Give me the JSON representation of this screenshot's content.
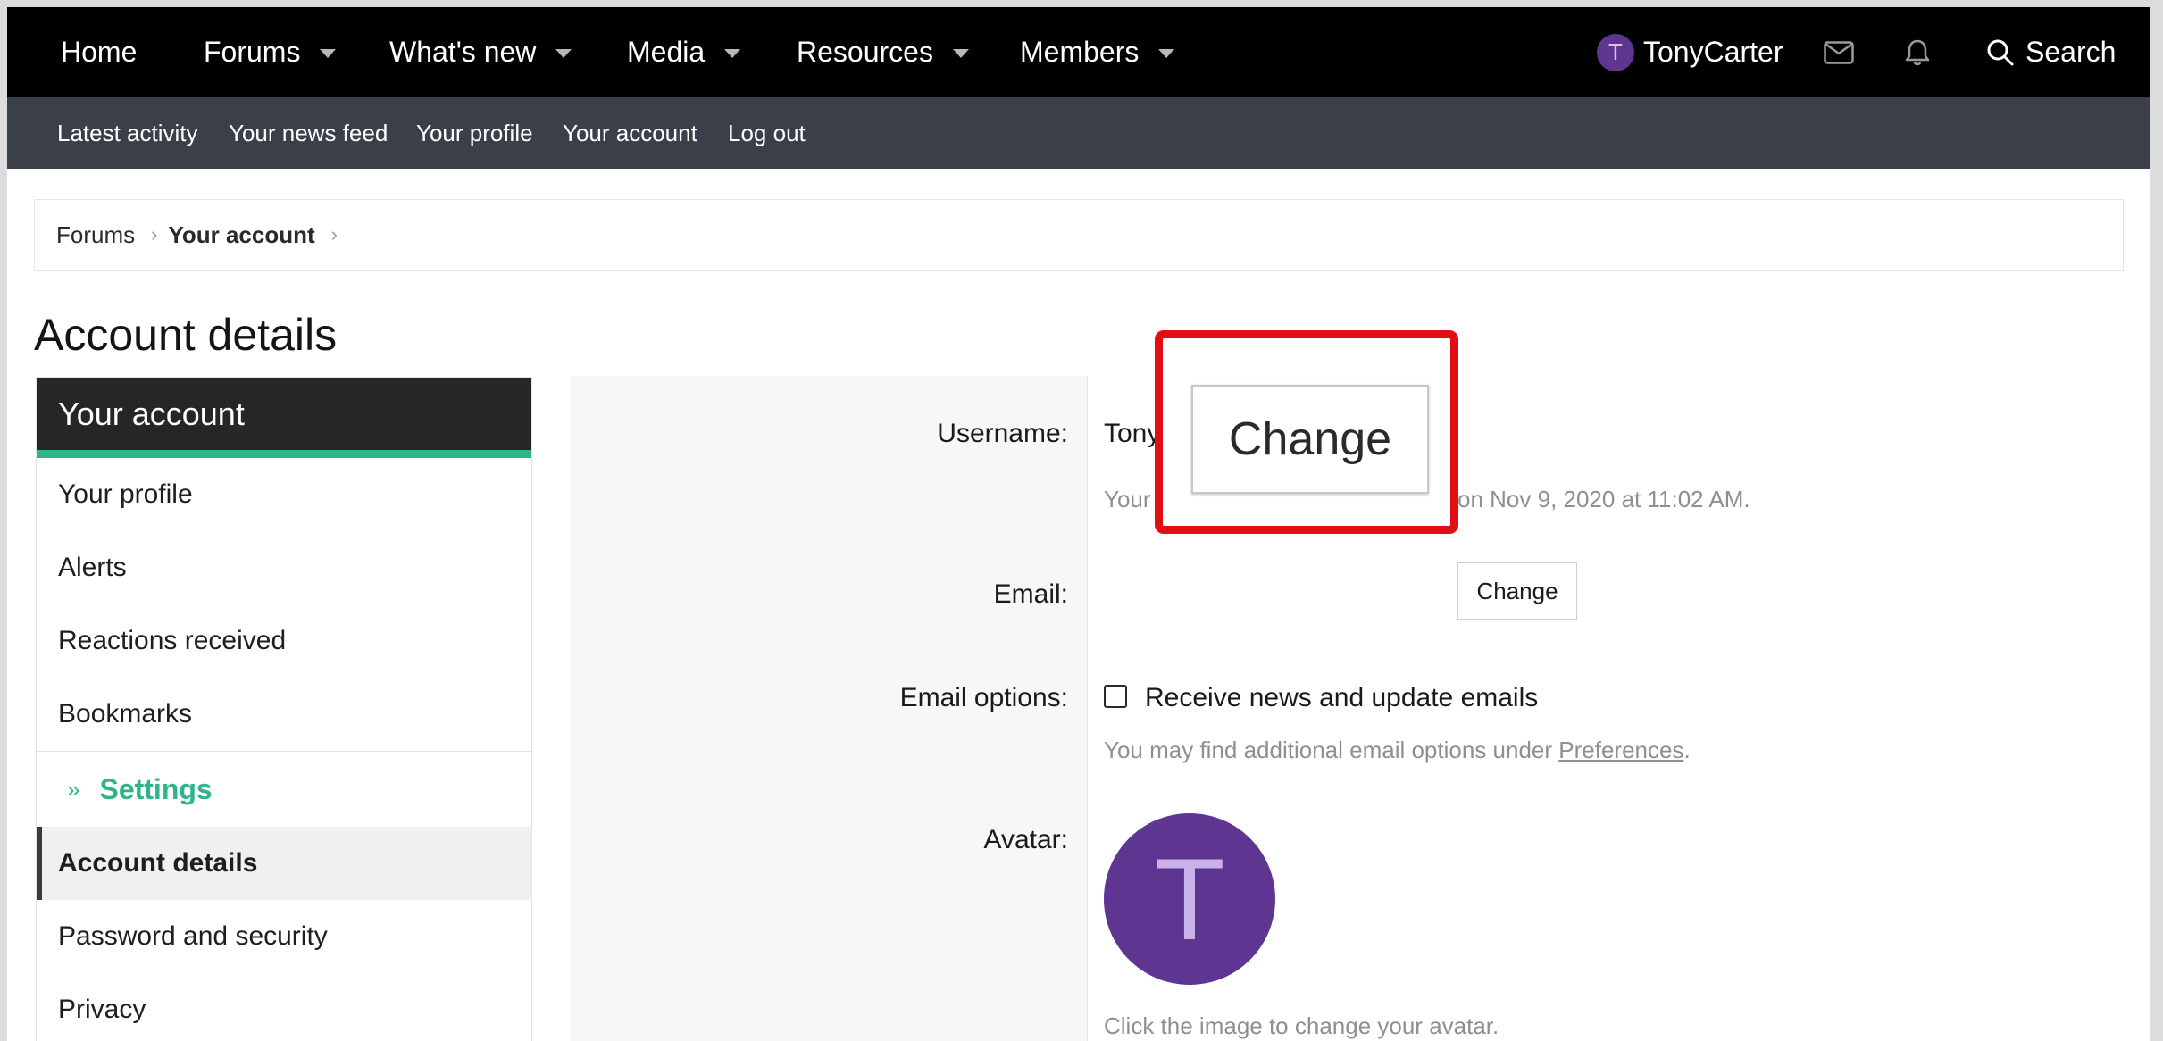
{
  "nav": {
    "home": "Home",
    "forums": "Forums",
    "whats_new": "What's new",
    "media": "Media",
    "resources": "Resources",
    "members": "Members",
    "user_initial": "T",
    "username": "TonyCarter",
    "search": "Search"
  },
  "subnav": {
    "latest_activity": "Latest activity",
    "news_feed": "Your news feed",
    "profile": "Your profile",
    "account": "Your account",
    "logout": "Log out"
  },
  "breadcrumb": {
    "forums": "Forums",
    "current": "Your account"
  },
  "page_title": "Account details",
  "sidebar": {
    "header": "Your account",
    "items": [
      "Your profile",
      "Alerts",
      "Reactions received",
      "Bookmarks"
    ],
    "section": "Settings",
    "settings_items": [
      "Account details",
      "Password and security",
      "Privacy"
    ]
  },
  "form": {
    "username_label": "Username:",
    "username_value": "Tony",
    "username_hint_start": "Your",
    "username_hint_end": "on Nov 9, 2020 at 11:02 AM.",
    "email_label": "Email:",
    "email_change": "Change",
    "email_options_label": "Email options:",
    "receive_news": "Receive news and update emails",
    "email_hint_prefix": "You may find additional email options under ",
    "preferences_link": "Preferences",
    "email_hint_suffix": ".",
    "avatar_label": "Avatar:",
    "avatar_initial": "T",
    "avatar_hint": "Click the image to change your avatar."
  },
  "highlight": {
    "button_label": "Change",
    "color": "#e10f14"
  },
  "colors": {
    "accent": "#2fb58a",
    "avatar": "#5e3590",
    "nav_bg": "#000000",
    "subnav_bg": "#3b3f49"
  }
}
